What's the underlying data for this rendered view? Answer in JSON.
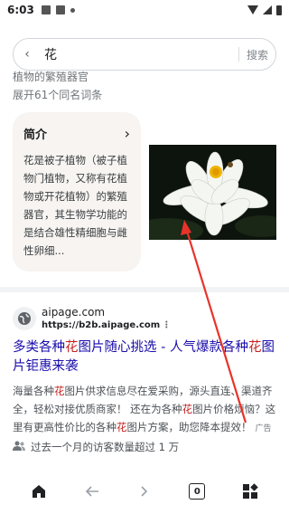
{
  "status": {
    "time": "6:03",
    "icons": [
      "photo-icon",
      "image-icon",
      "dot-icon"
    ],
    "right_icons": [
      "wifi-icon",
      "signal-icon",
      "battery-icon"
    ]
  },
  "search": {
    "query": "花",
    "button_label": "搜索",
    "back_icon": "chevron-left-icon"
  },
  "snippet": {
    "cut_text": "植物的繁殖器官",
    "expand_text": "展开61个同名词条"
  },
  "card": {
    "title": "简介",
    "body": "花是被子植物（被子植物门植物，又称有花植物或开花植物）的繁殖器官，其生物学功能的是结合雄性精细胞与雌性卵细..."
  },
  "result": {
    "site_name": "aipage.com",
    "site_url": "https://b2b.aipage.com",
    "more": "⋮",
    "title_parts": [
      "多类各种",
      "花",
      "图片随心挑选 - 人气爆款各种",
      "花",
      "图片钜惠来袭"
    ],
    "desc_parts": [
      "海量各种",
      "花",
      "图片供求信息尽在爱采购，源头直连、渠道齐全，轻松对接优质商家！ 还在为各种",
      "花",
      "图片价格烦恼？这里有更高性价比的各种",
      "花",
      "图片方案，助您降本提效！"
    ],
    "ad_label": "广告",
    "visits": "过去一个月的访客数量超过 1 万"
  },
  "nav": {
    "tab_count": "0",
    "items": [
      "home-icon",
      "back-arrow-icon",
      "forward-arrow-icon",
      "tabs-icon",
      "apps-icon"
    ]
  },
  "colors": {
    "link": "#1a0dab",
    "highlight": "#c5221f",
    "annotation": "#e8332a",
    "card_bg": "#f7f4f1"
  }
}
